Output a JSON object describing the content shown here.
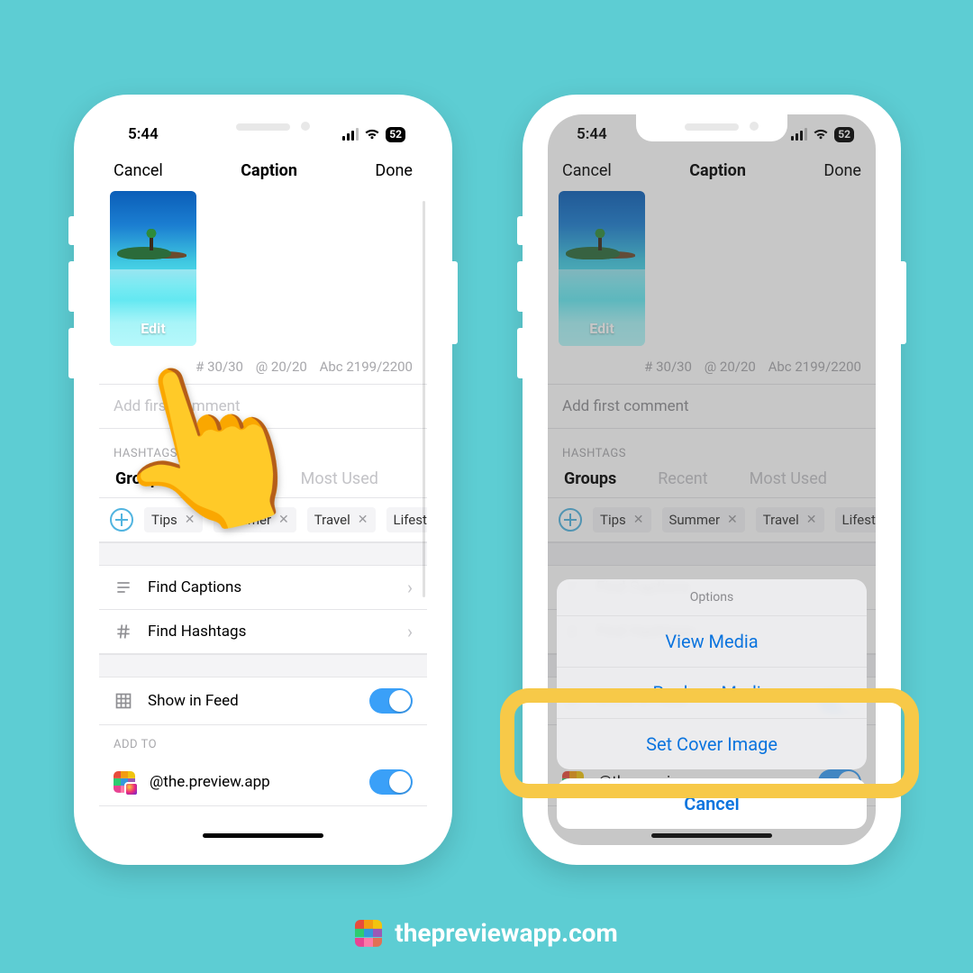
{
  "status": {
    "time": "5:44",
    "battery": "52"
  },
  "nav": {
    "cancel": "Cancel",
    "title": "Caption",
    "done": "Done"
  },
  "thumb": {
    "edit": "Edit"
  },
  "counters": {
    "hash": "# 30/30",
    "at": "@ 20/20",
    "abc": "Abc 2199/2200"
  },
  "first_comment_placeholder": "Add first comment",
  "hashtags": {
    "label": "HASHTAGS",
    "tabs": {
      "groups": "Groups",
      "recent": "Recent",
      "most_used": "Most Used"
    },
    "chips": {
      "tips": "Tips",
      "summer": "Summer",
      "travel": "Travel",
      "lifestyle": "Lifestyle"
    }
  },
  "rows": {
    "find_captions": "Find Captions",
    "find_hashtags": "Find Hashtags",
    "show_in_feed": "Show in Feed"
  },
  "add_to": {
    "label": "ADD TO",
    "account": "@the.preview.app"
  },
  "sheet": {
    "options": "Options",
    "view_media": "View Media",
    "replace_media": "Replace Media",
    "set_cover": "Set Cover Image",
    "cancel": "Cancel"
  },
  "footer": "thepreviewapp.com"
}
